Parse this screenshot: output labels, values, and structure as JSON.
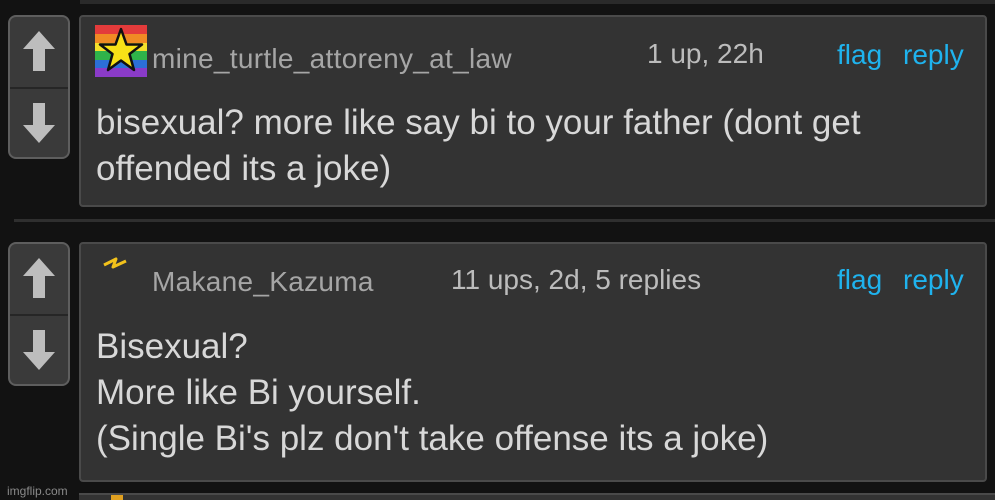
{
  "comments": [
    {
      "avatar": "rainbow-star-icon",
      "username": "mine_turtle_attoreny_at_law",
      "meta": "1 up, 22h",
      "flag_label": "flag",
      "reply_label": "reply",
      "lines": [
        "bisexual? more like say bi to your father (dont get",
        "offended its a joke)"
      ]
    },
    {
      "avatar": "lightning-icon",
      "username": "Makane_Kazuma",
      "meta": "11 ups, 2d, 5 replies",
      "flag_label": "flag",
      "reply_label": "reply",
      "lines": [
        "Bisexual?",
        "More like Bi yourself.",
        "(Single Bi's plz don't take offense its a joke)"
      ]
    }
  ],
  "watermark": "imgflip.com",
  "colors": {
    "background": "#121212",
    "panel": "#333333",
    "link": "#1fb3ee",
    "username": "#a6a6a6",
    "text": "#d8d8d8"
  }
}
